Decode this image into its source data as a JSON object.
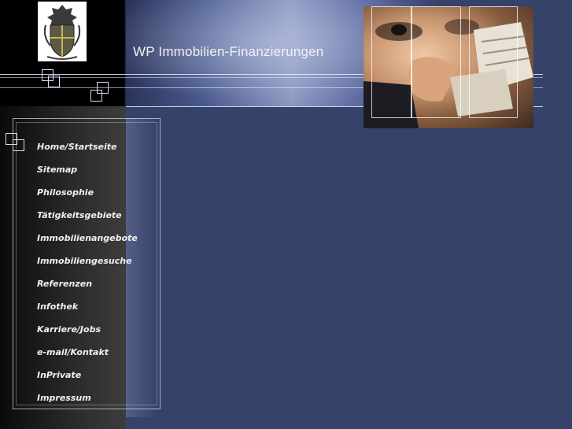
{
  "header": {
    "title": "WP Immobilien-Finanzierungen",
    "logo_icon": "coat-of-arms-icon"
  },
  "nav": {
    "items": [
      {
        "label": "Home/Startseite"
      },
      {
        "label": "Sitemap"
      },
      {
        "label": "Philosophie"
      },
      {
        "label": "Tätigkeitsgebiete"
      },
      {
        "label": "Immobilienangebote"
      },
      {
        "label": "Immobiliengesuche"
      },
      {
        "label": "Referenzen"
      },
      {
        "label": "Infothek"
      },
      {
        "label": "Karriere/Jobs"
      },
      {
        "label": "e-mail/Kontakt"
      },
      {
        "label": "InPrivate"
      },
      {
        "label": "Impressum"
      }
    ]
  },
  "colors": {
    "background": "#35426a",
    "sidebar": "#2b2b2b",
    "text": "#f0f0f0"
  }
}
